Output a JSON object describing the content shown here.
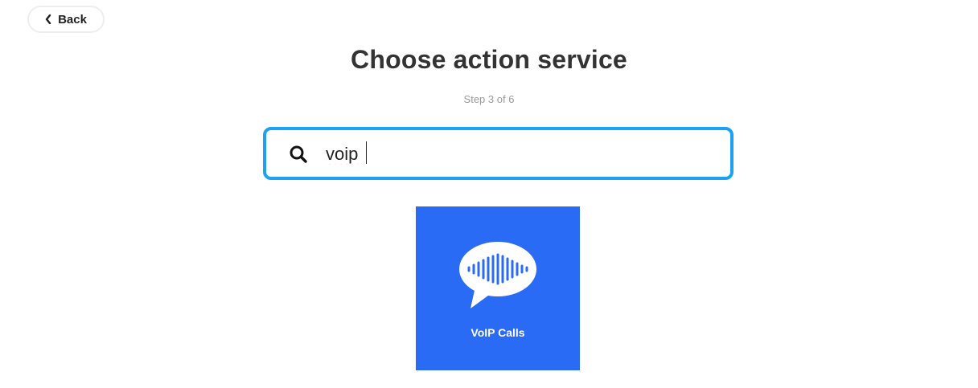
{
  "header": {
    "back_label": "Back",
    "back_icon": "chevron-left-icon"
  },
  "main": {
    "title": "Choose action service",
    "step": "Step 3 of 6"
  },
  "search": {
    "icon": "search-icon",
    "value": "voip",
    "accent_color": "#1da1f2"
  },
  "results": [
    {
      "name": "VoIP Calls",
      "icon": "voice-chat-bubble-icon",
      "color": "#2a6bf6"
    }
  ]
}
